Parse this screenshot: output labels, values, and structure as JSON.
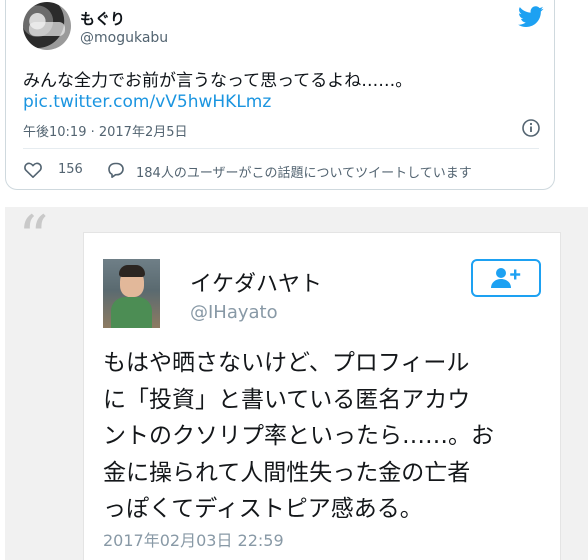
{
  "tweet": {
    "author_name": "もぐり",
    "author_handle": "@mogukabu",
    "text": "みんな全力でお前が言うなって思ってるよね……。",
    "link": "pic.twitter.com/vV5hwHKLmz",
    "timestamp": "午後10:19 · 2017年2月5日",
    "likes": "156",
    "replies_text": "184人のユーザーがこの話題についてツイートしています"
  },
  "quoted_image": {
    "author_name": "イケダハヤト",
    "author_handle": "@IHayato",
    "body_lines": [
      "もはや晒さないけど、プロフィール",
      "に「投資」と書いている匿名アカウ",
      "ントのクソリプ率といったら……。お",
      "金に操られて人間性失った金の亡者",
      "っぽくてディストピア感ある。"
    ],
    "date": "2017年02月03日 22:59"
  },
  "icons": {
    "brand": "twitter-bird-icon",
    "info": "info-icon",
    "like": "heart-icon",
    "reply": "reply-icon",
    "follow": "add-user-icon"
  },
  "colors": {
    "brand_blue": "#1da1f2",
    "link_blue": "#1b95e0",
    "muted_text": "#536471",
    "quote_background": "#f1f1f1"
  }
}
